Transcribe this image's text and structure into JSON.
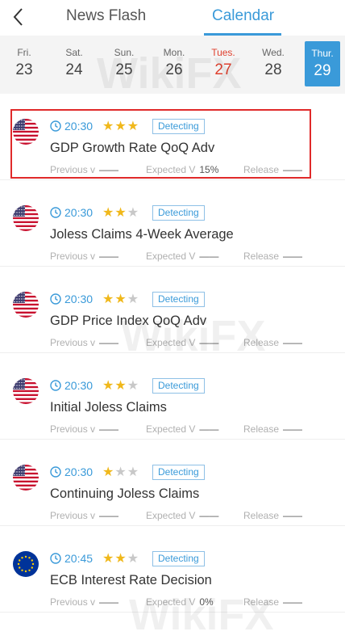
{
  "header": {
    "tab_news": "News Flash",
    "tab_calendar": "Calendar"
  },
  "days": [
    {
      "dow": "Fri.",
      "num": "23",
      "state": "normal"
    },
    {
      "dow": "Sat.",
      "num": "24",
      "state": "normal"
    },
    {
      "dow": "Sun.",
      "num": "25",
      "state": "normal"
    },
    {
      "dow": "Mon.",
      "num": "26",
      "state": "normal"
    },
    {
      "dow": "Tues.",
      "num": "27",
      "state": "red"
    },
    {
      "dow": "Wed.",
      "num": "28",
      "state": "normal"
    },
    {
      "dow": "Thur.",
      "num": "29",
      "state": "active"
    }
  ],
  "labels": {
    "previous": "Previous v",
    "expected": "Expected V",
    "release": "Release"
  },
  "events": [
    {
      "flag": "us-flag",
      "time": "20:30",
      "stars": 3,
      "badge": "Detecting",
      "title": "GDP Growth Rate QoQ Adv",
      "previous": "——",
      "expected": "15%",
      "release": "——",
      "highlight": true
    },
    {
      "flag": "us-flag",
      "time": "20:30",
      "stars": 2,
      "badge": "Detecting",
      "title": "Joless Claims 4-Week Average",
      "previous": "——",
      "expected": "——",
      "release": "——",
      "highlight": false
    },
    {
      "flag": "us-flag",
      "time": "20:30",
      "stars": 2,
      "badge": "Detecting",
      "title": "GDP Price Index QoQ Adv",
      "previous": "——",
      "expected": "——",
      "release": "——",
      "highlight": false
    },
    {
      "flag": "us-flag",
      "time": "20:30",
      "stars": 2,
      "badge": "Detecting",
      "title": "Initial Joless Claims",
      "previous": "——",
      "expected": "——",
      "release": "——",
      "highlight": false
    },
    {
      "flag": "us-flag",
      "time": "20:30",
      "stars": 1,
      "badge": "Detecting",
      "title": "Continuing Joless Claims",
      "previous": "——",
      "expected": "——",
      "release": "——",
      "highlight": false
    },
    {
      "flag": "eu-flag",
      "time": "20:45",
      "stars": 2,
      "badge": "Detecting",
      "title": "ECB Interest Rate Decision",
      "previous": "——",
      "expected": "0%",
      "release": "——",
      "highlight": false
    }
  ],
  "watermark": "WikiFX",
  "colors": {
    "accent": "#3a9ad9",
    "star": "#f0b81b",
    "highlight": "#e02a2a",
    "weekday_red": "#e0412f"
  }
}
